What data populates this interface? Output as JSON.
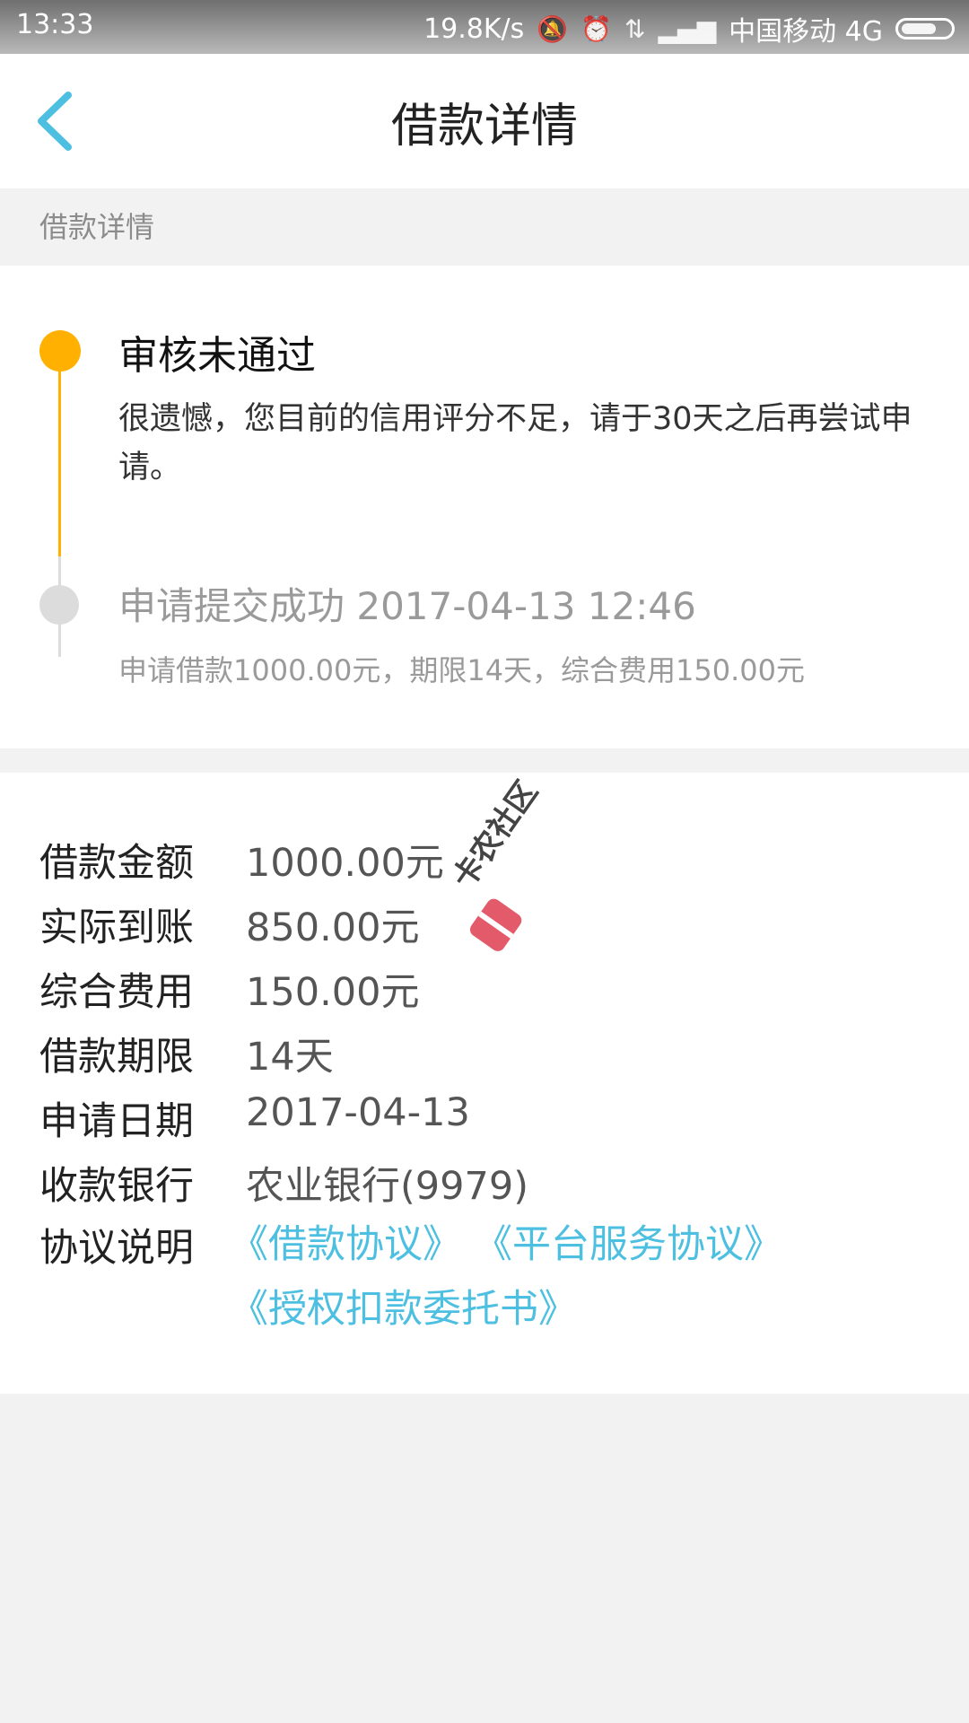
{
  "status_bar": {
    "time": "13:33",
    "speed": "19.8K/s",
    "carrier": "中国移动 4G",
    "icons": [
      "bell-off-icon",
      "alarm-icon",
      "data-arrows-icon",
      "signal-icon",
      "battery-icon"
    ]
  },
  "header": {
    "title": "借款详情",
    "back_icon": "chevron-left-icon"
  },
  "section_label": "借款详情",
  "timeline": {
    "step1": {
      "title": "审核未通过",
      "desc": "很遗憾，您目前的信用评分不足，请于30天之后再尝试申请。",
      "color": "#ffb000"
    },
    "step2": {
      "title": "申请提交成功 2017-04-13 12:46",
      "desc": "申请借款1000.00元，期限14天，综合费用150.00元",
      "color": "#dcdcdc"
    }
  },
  "details": {
    "rows": [
      {
        "key": "借款金额",
        "value": "1000.00元"
      },
      {
        "key": "实际到账",
        "value": "850.00元"
      },
      {
        "key": "综合费用",
        "value": "150.00元"
      },
      {
        "key": "借款期限",
        "value": "14天"
      },
      {
        "key": "申请日期",
        "value": "2017-04-13"
      },
      {
        "key": "收款银行",
        "value": "农业银行(9979)"
      }
    ],
    "agreement_key": "协议说明",
    "links": [
      "《借款协议》",
      "《平台服务协议》",
      "《授权扣款委托书》"
    ],
    "link_color": "#4dbfe0"
  },
  "watermark": {
    "text": "卡农社区"
  }
}
